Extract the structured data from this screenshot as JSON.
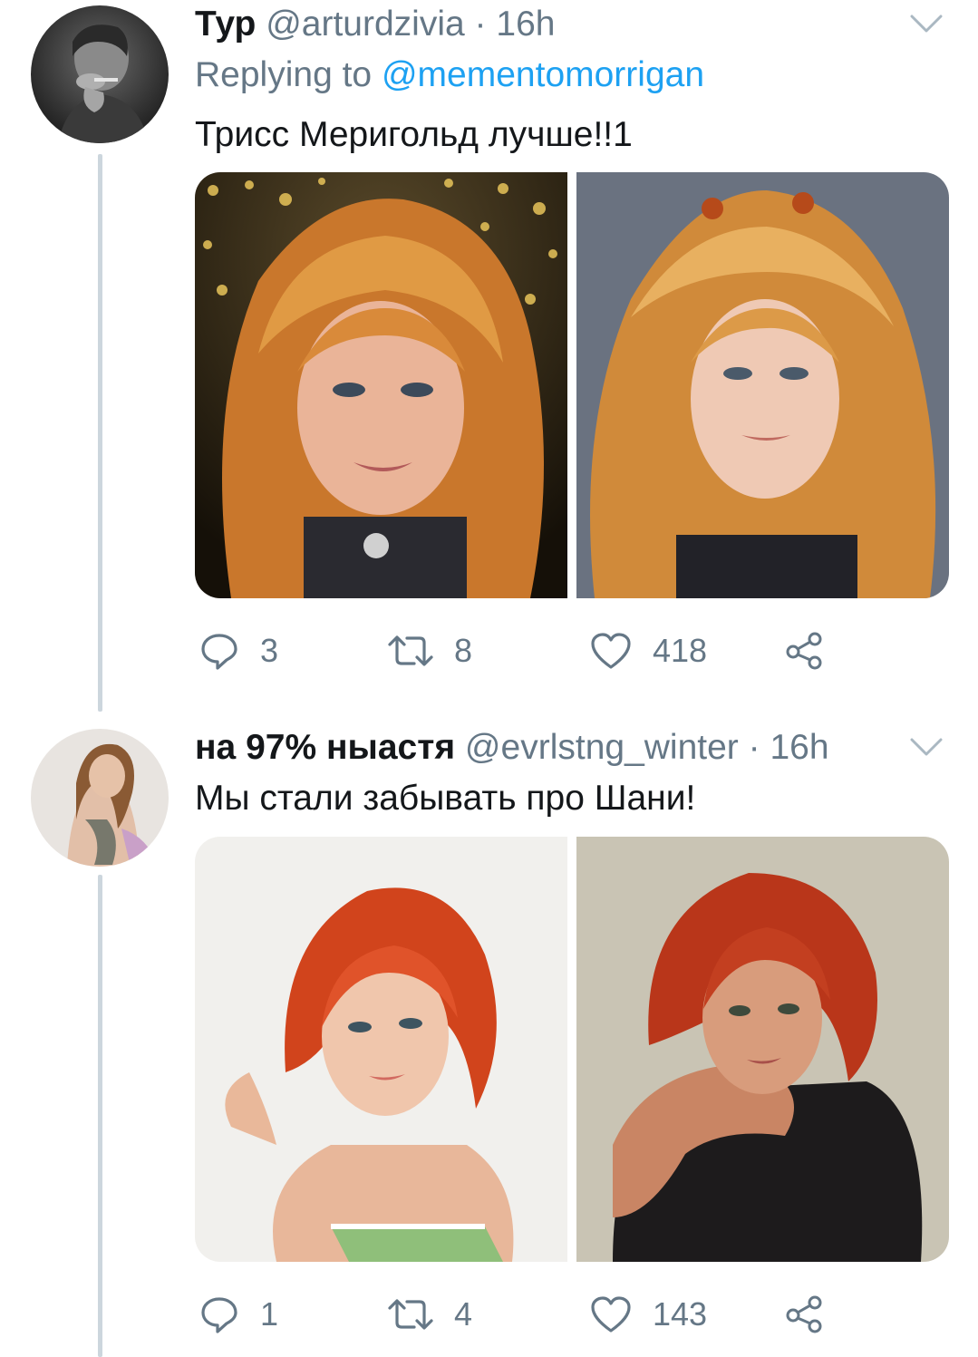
{
  "tweets": [
    {
      "display_name": "Тур",
      "handle": "@arturdzivia",
      "separator": "·",
      "time": "16h",
      "replying_prefix": "Replying to",
      "replying_to": "@mementomorrigan",
      "text": "Трисс Меригольд лучше!!1",
      "actions": {
        "replies": "3",
        "retweets": "8",
        "likes": "418"
      }
    },
    {
      "display_name": "на 97% ныастя",
      "handle": "@evrlstng_winter",
      "separator": "·",
      "time": "16h",
      "text": "Мы стали забывать про Шани!",
      "actions": {
        "replies": "1",
        "retweets": "4",
        "likes": "143"
      }
    }
  ],
  "icons": {
    "reply": "speech-bubble-icon",
    "retweet": "retweet-arrows-icon",
    "like": "heart-icon",
    "share": "share-nodes-icon",
    "menu": "chevron-down-icon"
  },
  "colors": {
    "text": "#14171a",
    "secondary": "#657786",
    "link": "#1da1f2",
    "thread_line": "#ccd6dd",
    "icon": "#657786"
  }
}
